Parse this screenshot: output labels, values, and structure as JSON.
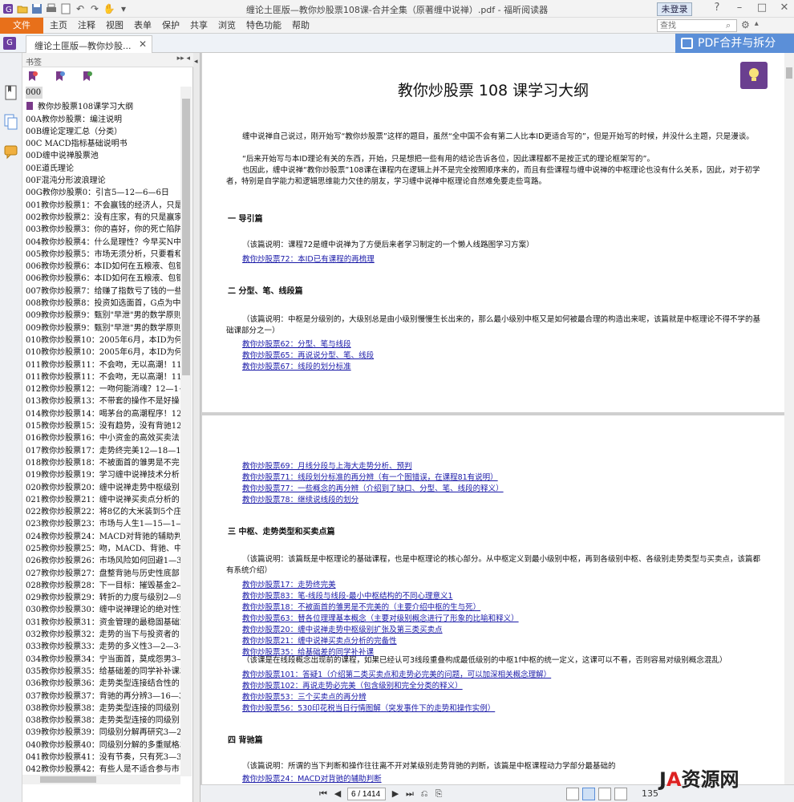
{
  "window": {
    "title": "缠论土匪版—教你炒股票108课-合并全集（原著缠中说禅）.pdf - 福昕阅读器",
    "login_label": "未登录"
  },
  "menubar": {
    "file_label": "文件",
    "items": [
      "主页",
      "注释",
      "视图",
      "表单",
      "保护",
      "共享",
      "浏览",
      "特色功能",
      "帮助"
    ],
    "search_placeholder": "查找"
  },
  "tab": {
    "doc_label": "缠论土匪版—教你炒股...",
    "merge_label": "PDF合并与拆分"
  },
  "bookmarks": {
    "header": "书签",
    "items": [
      {
        "label": "000",
        "selected": true,
        "flag": false
      },
      {
        "label": "教你炒股票108课学习大纲",
        "selected": false,
        "flag": true
      },
      {
        "label": "00A教你炒股票：编注说明",
        "selected": false,
        "flag": false
      },
      {
        "label": "00B缠论定理汇总（分类）",
        "selected": false,
        "flag": false
      },
      {
        "label": "00C MACD指标基础说明书",
        "selected": false,
        "flag": false
      },
      {
        "label": "00D缠中说禅股票池",
        "selected": false,
        "flag": false
      },
      {
        "label": "00E道氏理论",
        "selected": false,
        "flag": false
      },
      {
        "label": "00F混沌分形波浪理论",
        "selected": false,
        "flag": false
      },
      {
        "label": "00G教你炒股票0：引言5—12—6—6日",
        "selected": false,
        "flag": false
      },
      {
        "label": "001教你炒股票1：不会赢钱的经济人，只是",
        "selected": false,
        "flag": false
      },
      {
        "label": "002教你炒股票2：没有庄家，有的只是赢家",
        "selected": false,
        "flag": false
      },
      {
        "label": "003教你炒股票3：你的喜好，你的死亡陷阱",
        "selected": false,
        "flag": false
      },
      {
        "label": "004教你炒股票4：什么是理性？今早买N中",
        "selected": false,
        "flag": false
      },
      {
        "label": "005教你炒股票5：市场无须分析，只要看和",
        "selected": false,
        "flag": false
      },
      {
        "label": "006教你炒股票6：本ID如何在五粮液、包钢",
        "selected": false,
        "flag": false
      },
      {
        "label": "006教你炒股票6：本ID如何在五粮液、包钢",
        "selected": false,
        "flag": false
      },
      {
        "label": "007教你炒股票7：给赚了指数亏了钱的一些",
        "selected": false,
        "flag": false
      },
      {
        "label": "008教你炒股票8：投资如选面首，G点为中",
        "selected": false,
        "flag": false
      },
      {
        "label": "009教你炒股票9：甄别\"早泄\"男的数学原则",
        "selected": false,
        "flag": false
      },
      {
        "label": "009教你炒股票9：甄别\"早泄\"男的数学原则",
        "selected": false,
        "flag": false
      },
      {
        "label": "010教你炒股票10：2005年6月，本ID为何",
        "selected": false,
        "flag": false
      },
      {
        "label": "010教你炒股票10：2005年6月，本ID为何",
        "selected": false,
        "flag": false
      },
      {
        "label": "011教你炒股票11：不会吻，无以高潮！11",
        "selected": false,
        "flag": false
      },
      {
        "label": "011教你炒股票11：不会吻，无以高潮！11",
        "selected": false,
        "flag": false
      },
      {
        "label": "012教你炒股票12：一吻何能消魂？12—1~",
        "selected": false,
        "flag": false
      },
      {
        "label": "013教你炒股票13：不带套的操作不是好操",
        "selected": false,
        "flag": false
      },
      {
        "label": "014教你炒股票14：喝茅台的高潮程序！12",
        "selected": false,
        "flag": false
      },
      {
        "label": "015教你炒股票15：没有趋势，没有背驰12",
        "selected": false,
        "flag": false
      },
      {
        "label": "016教你炒股票16：中小资金的高效买卖法1",
        "selected": false,
        "flag": false
      },
      {
        "label": "017教你炒股票17：走势终完美12—18—12",
        "selected": false,
        "flag": false
      },
      {
        "label": "018教你炒股票18：不被面首的雏男是不完",
        "selected": false,
        "flag": false
      },
      {
        "label": "019教你炒股票19：学习缠中说禅技术分析",
        "selected": false,
        "flag": false
      },
      {
        "label": "020教你炒股票20：缠中说禅走势中枢级别",
        "selected": false,
        "flag": false
      },
      {
        "label": "021教你炒股票21：缠中说禅买卖点分析的",
        "selected": false,
        "flag": false
      },
      {
        "label": "022教你炒股票22：将8亿的大米装到5个庄",
        "selected": false,
        "flag": false
      },
      {
        "label": "023教你炒股票23：市场与人生1—15—1—",
        "selected": false,
        "flag": false
      },
      {
        "label": "024教你炒股票24：MACD对背驰的辅助判断",
        "selected": false,
        "flag": false
      },
      {
        "label": "025教你炒股票25：吻，MACD、背驰、中枢",
        "selected": false,
        "flag": false
      },
      {
        "label": "026教你炒股票26：市场风险如何回避1—30",
        "selected": false,
        "flag": false
      },
      {
        "label": "027教你炒股票27：盘整背驰与历史性底部",
        "selected": false,
        "flag": false
      },
      {
        "label": "028教你炒股票28：下一目标：摧毁基金2—",
        "selected": false,
        "flag": false
      },
      {
        "label": "029教你炒股票29：转折的力度与级别2—9",
        "selected": false,
        "flag": false
      },
      {
        "label": "030教你炒股票30：缠中说禅理论的绝对性2",
        "selected": false,
        "flag": false
      },
      {
        "label": "031教你炒股票31：资金管理的最稳固基础2",
        "selected": false,
        "flag": false
      },
      {
        "label": "032教你炒股票32：走势的当下与投资者的",
        "selected": false,
        "flag": false
      },
      {
        "label": "033教你炒股票33：走势的多义性3—2—3—",
        "selected": false,
        "flag": false
      },
      {
        "label": "034教你炒股票34：宁当面首，莫成怨男3—",
        "selected": false,
        "flag": false
      },
      {
        "label": "035教你炒股票35：给基础差的同学补补课3",
        "selected": false,
        "flag": false
      },
      {
        "label": "036教你炒股票36：走势类型连接结合性的",
        "selected": false,
        "flag": false
      },
      {
        "label": "037教你炒股票37：背驰的再分辨3—16—3",
        "selected": false,
        "flag": false
      },
      {
        "label": "038教你炒股票38：走势类型连接的同级别",
        "selected": false,
        "flag": false
      },
      {
        "label": "038教你炒股票38：走势类型连接的同级别",
        "selected": false,
        "flag": false
      },
      {
        "label": "039教你炒股票39：同级别分解再研究3—23",
        "selected": false,
        "flag": false
      },
      {
        "label": "040教你炒股票40：同级别分解的多重赋格3",
        "selected": false,
        "flag": false
      },
      {
        "label": "041教你炒股票41：没有节奏，只有死3—30",
        "selected": false,
        "flag": false
      },
      {
        "label": "042教你炒股票42：有些人是不适合参与市",
        "selected": false,
        "flag": false
      }
    ]
  },
  "document": {
    "page1": {
      "title": "教你炒股票 108 课学习大纲",
      "para1": "缠中说禅自己说过，刚开始写“教你炒股票”这样的题目，虽然“全中国不会有第二人比本ID更适合写的”，但是开始写的时候，并没什么主题，只是漫谈。",
      "para2": "“后来开始写与本ID理论有关的东西，开始，只是想把一些有用的结论告诉各位，因此课程都不是按正式的理论框架写的”。",
      "para3": "也因此，缠中说禅“教你炒股票”108课在课程内在逻辑上并不是完全按照顺序来的，而且有些课程与缠中说禅的中枢理论也没有什么关系，因此，对于初学者，特别是自学能力和逻辑思维能力欠佳的朋友，学习缠中说禅中枢理论自然难免要走些弯路。",
      "sec1_title": "一 导引篇",
      "sec1_note": "（该篇说明：课程72是缠中说禅为了方便后来者学习制定的一个懒人线路图学习方案）",
      "sec1_links": [
        "教你炒股票72：本ID已有课程的再梳理"
      ],
      "sec2_title": "二 分型、笔、线段篇",
      "sec2_note": "（该篇说明：中枢是分级别的，大级别总是由小级别慢慢生长出来的，那么最小级别中枢又是如何被最合理的构造出来呢，该篇就是中枢理论不得不学的基础课部分之一）",
      "sec2_links": [
        "教你炒股票62：分型、笔与线段",
        "教你炒股票65：再说说分型、笔、线段",
        "教你炒股票67：线段的划分标准"
      ]
    },
    "page2": {
      "top_links": [
        "教你炒股票69：月线分段与上海大走势分析、预判",
        "教你炒股票71：线段划分标准的再分辨（有一个图错误，在课程81有说明）",
        "教你炒股票77：一些概念的再分辨（介绍到了缺口、分型、笔、线段的释义）",
        "教你炒股票78：继续说线段的划分"
      ],
      "sec3_title": "三 中枢、走势类型和买卖点篇",
      "sec3_note": "（该篇说明：该篇既是中枢理论的基础课程，也是中枢理论的核心部分。从中枢定义到最小级别中枢，再到各级别中枢、各级别走势类型与买卖点，该篇都有系统介绍）",
      "sec3_links_a": [
        "教你炒股票17：走势终完美",
        "教你炒股票83：笔-线段与线段-最小中枢结构的不同心理意义1",
        "教你炒股票18：不被面首的雏男是不完美的（主要介绍中枢的生与死）",
        "教你炒股票63：替各位理理基本概念（主要对级别概念进行了形象的比喻和释义）",
        "教你炒股票20：缠中说禅走势中枢级别扩张及第三类买卖点",
        "教你炒股票21：缠中说禅买卖点分析的完备性",
        "教你炒股票35：给基础差的同学补补课"
      ],
      "sec3_mid_note": "（该课是在线段概念出现前的课程，如果已经认可3线段重叠构成最低级别的中枢1f中枢的统一定义，这课可以不看，否则容易对级别概念混乱）",
      "sec3_links_b": [
        "教你炒股票101：答疑1（介绍第二类买卖点和走势必完美的问题，可以加深相关概念理解）",
        "教你炒股票102：再说走势必完美（包含级别和完全分类的释义）",
        "教你炒股票53：三个买卖点的再分辨",
        "教你炒股票56：530印花税当日行情图解（突发事件下的走势和操作实例）"
      ],
      "sec4_title": "四 背驰篇",
      "sec4_note": "（该篇说明：所谓的当下判断和操作往往离不开对某级别走势背驰的判断，该篇是中枢课程动力学部分最基础的",
      "sec4_links": [
        "教你炒股票24：MACD对背驰的辅助判断"
      ]
    }
  },
  "statusbar": {
    "page_field": "6 / 1414",
    "zoom": "135"
  },
  "watermark": {
    "a_text": "A",
    "rest_text": "资源网"
  },
  "colors": {
    "accent_orange": "#e8701a",
    "merge_blue": "#5b8fd8",
    "link_blue": "#1a1aa8",
    "bookmark_purple": "#7a3a8a"
  }
}
